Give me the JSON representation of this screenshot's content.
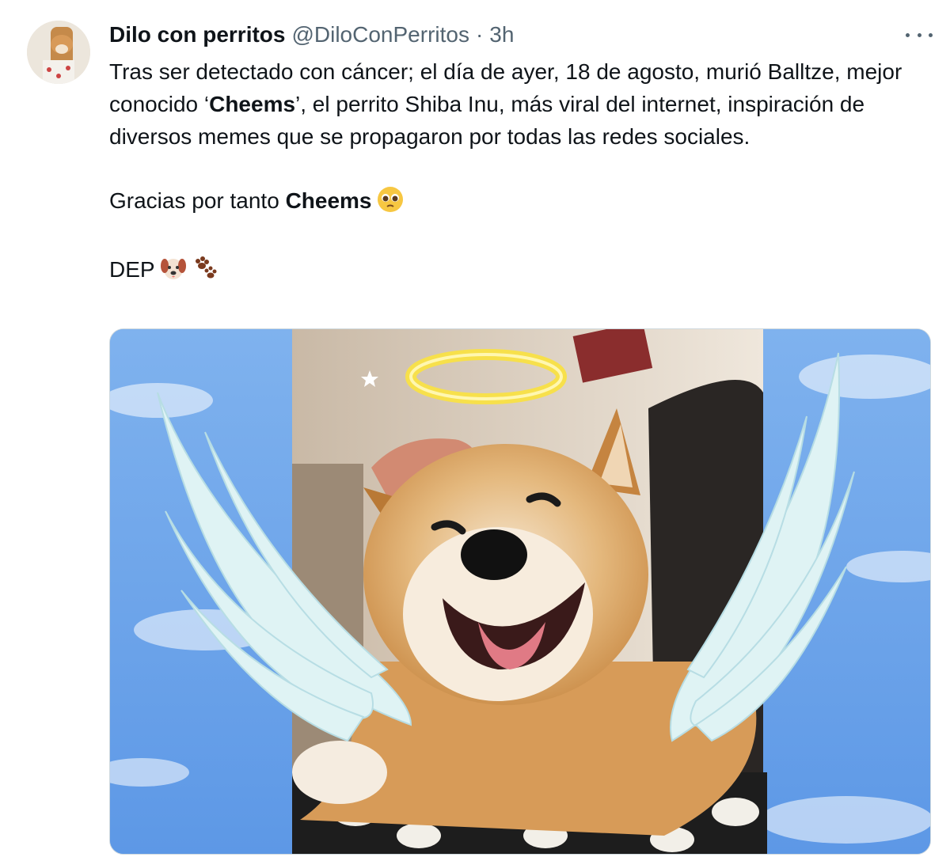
{
  "author": {
    "display_name": "Dilo con perritos",
    "handle": "@DiloConPerritos",
    "separator": "·",
    "time": "3h"
  },
  "more_icon": "more-horizontal-icon",
  "tweet": {
    "line1": "Tras ser detectado con cáncer; el día de ayer, 18 de agosto, murió  Balltze, mejor conocido ‘",
    "cheems_1": "Cheems",
    "line1_rest": "’, el perrito  Shiba Inu, más viral del internet, inspiración de diversos memes que se propagaron por todas las redes sociales.",
    "thanks_prefix": "Gracias por tanto ",
    "cheems_2": "Cheems",
    "thanks_emoji": "pleading-face-emoji",
    "dep": "DEP",
    "dep_emojis": [
      "dog-face-emoji",
      "paw-prints-emoji"
    ]
  },
  "media": {
    "subject": "shiba-inu-with-angel-wings-and-halo"
  },
  "colors": {
    "text": "#0f1419",
    "secondary": "#536471",
    "sky": "#6aa3ea",
    "halo": "#f7e04b"
  }
}
